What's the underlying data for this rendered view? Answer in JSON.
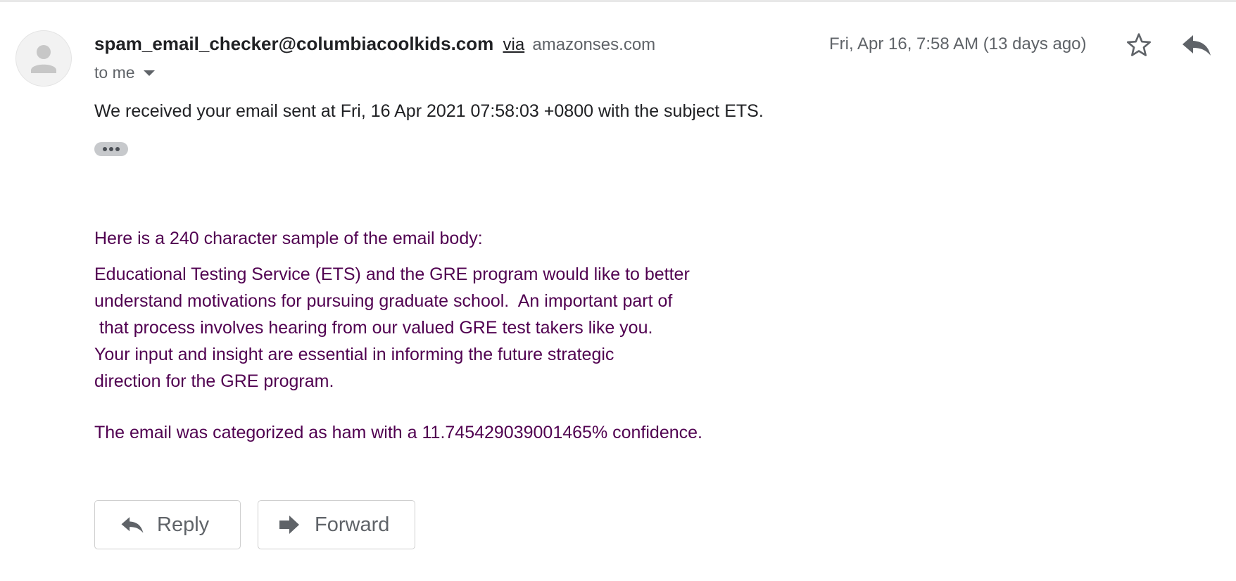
{
  "message": {
    "sender_email": "spam_email_checker@columbiacoolkids.com",
    "via_label": "via",
    "via_domain": "amazonses.com",
    "recipient": "to me",
    "date": "Fri, Apr 16, 7:58 AM (13 days ago)",
    "received_text": "We received your email sent at Fri, 16 Apr 2021 07:58:03 +0800 with the subject ETS.",
    "sample_heading": "Here is a 240 character sample of the email body:",
    "body_lines": "Educational Testing Service (ETS) and the GRE program would like to better\nunderstand motivations for pursuing graduate school.  An important part of\n that process involves hearing from our valued GRE test takers like you.\nYour input and insight are essential in informing the future strategic\ndirection for the GRE program.",
    "categorized_text": "The email was categorized as ham with a 11.745429039001465% confidence."
  },
  "actions": {
    "reply_label": "Reply",
    "forward_label": "Forward"
  },
  "icons": {
    "avatar": "person-icon",
    "star": "star-icon",
    "reply": "reply-icon",
    "forward": "forward-icon",
    "expand": "ellipsis-icon",
    "recipient_details": "caret-down-icon"
  },
  "colors": {
    "body_text": "#500050",
    "secondary_text": "#5f6368",
    "primary_text": "#202124"
  }
}
